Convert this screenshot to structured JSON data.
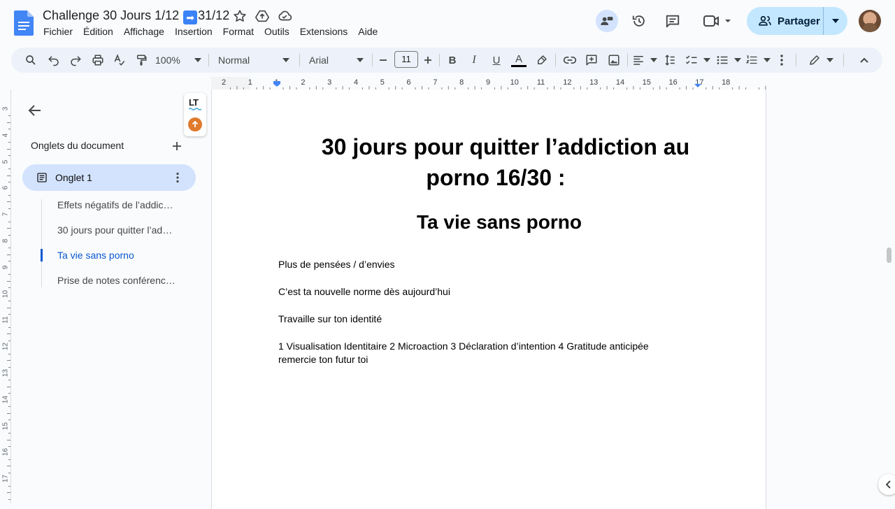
{
  "title_bar": {
    "doc_title_before": "Challenge 30 Jours 1/12",
    "doc_title_arrow": "➡",
    "doc_title_after": "31/12",
    "menu": [
      "Fichier",
      "Édition",
      "Affichage",
      "Insertion",
      "Format",
      "Outils",
      "Extensions",
      "Aide"
    ],
    "share_label": "Partager"
  },
  "toolbar": {
    "zoom": "100%",
    "style": "Normal",
    "font": "Arial",
    "font_size": "11",
    "bold": "B",
    "italic": "I",
    "underline": "U",
    "text_color": "A"
  },
  "ruler": {
    "h_labels": [
      "2",
      "1",
      "1",
      "2",
      "3",
      "4",
      "5",
      "6",
      "7",
      "8",
      "9",
      "10",
      "11",
      "12",
      "13",
      "14",
      "15",
      "16",
      "17",
      "18"
    ],
    "v_labels": [
      "3",
      "4",
      "5",
      "6",
      "7",
      "8",
      "9",
      "10",
      "11",
      "12",
      "13",
      "14",
      "15",
      "16",
      "17"
    ]
  },
  "sidebar": {
    "heading": "Onglets du document",
    "tab_label": "Onglet 1",
    "outline": [
      {
        "text": "Effets négatifs de l’addic…",
        "active": false
      },
      {
        "text": "30 jours pour quitter l’ad…",
        "active": false
      },
      {
        "text": "Ta vie sans porno",
        "active": true
      },
      {
        "text": "Prise de notes conférenc…",
        "active": false
      }
    ]
  },
  "lt_widget": {
    "logo": "LT"
  },
  "document": {
    "heading1_line1": "30 jours pour quitter l’addiction au",
    "heading1_line2": "porno 16/30 :",
    "heading2": "Ta vie sans porno",
    "paragraphs": [
      "Plus de pensées / d’envies",
      "C’est ta nouvelle norme dès aujourd’hui",
      "Travaille sur ton identité",
      "1 Visualisation Identitaire 2 Microaction 3 Déclaration d’intention 4 Gratitude anticipée remercie ton futur toi"
    ]
  },
  "colors": {
    "accent_blue": "#0b57d0",
    "share_bg": "#c2e7ff",
    "tab_active_bg": "#d3e3fd",
    "toolbar_bg": "#edf2fa",
    "lt_orange": "#e07a2c"
  }
}
